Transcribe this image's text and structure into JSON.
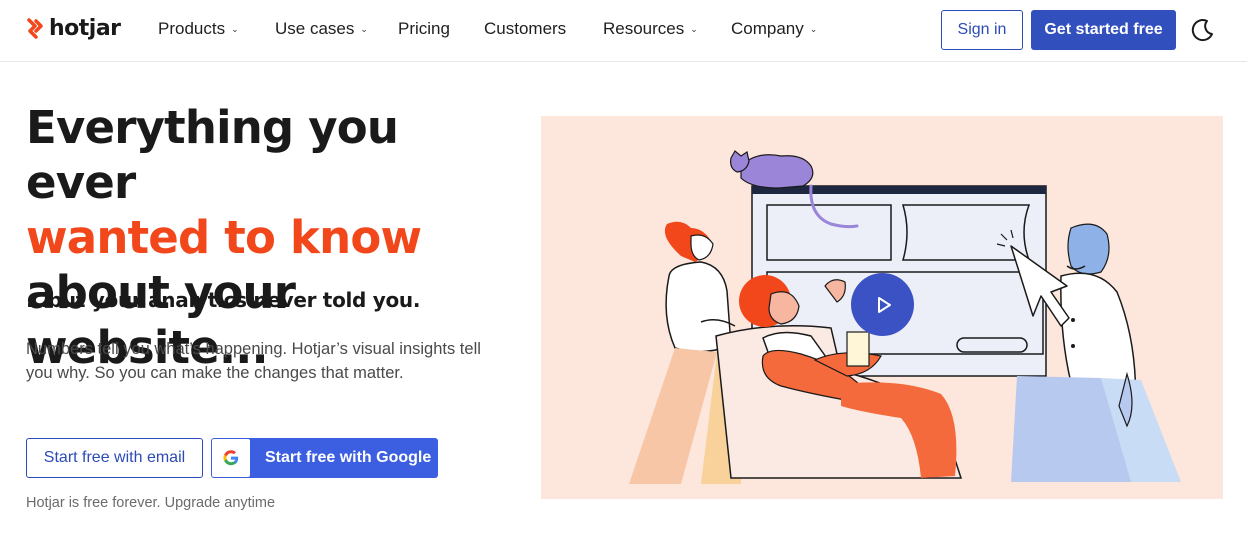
{
  "brand": {
    "name": "hotjar",
    "accent": "#f2461b",
    "primary": "#324fbe"
  },
  "nav": {
    "items": [
      {
        "label": "Products",
        "has_dropdown": true
      },
      {
        "label": "Use cases",
        "has_dropdown": true
      },
      {
        "label": "Pricing",
        "has_dropdown": false
      },
      {
        "label": "Customers",
        "has_dropdown": false
      },
      {
        "label": "Resources",
        "has_dropdown": true
      },
      {
        "label": "Company",
        "has_dropdown": true
      }
    ],
    "signin_label": "Sign in",
    "cta_label": "Get started free",
    "theme_icon": "moon-icon"
  },
  "hero": {
    "headline_part1": "Everything you ever",
    "headline_highlight": "wanted to know",
    "headline_part2": " about your website...",
    "subhead": "...but your analytics never told you.",
    "body": "Numbers tell you what’s happening. Hotjar’s visual insights tell you why. So you can make the changes that matter.",
    "email_button": "Start free with email",
    "google_button": "Start free with Google",
    "footnote": "Hotjar is free forever. Upgrade anytime"
  },
  "media": {
    "play_icon": "play-icon"
  }
}
